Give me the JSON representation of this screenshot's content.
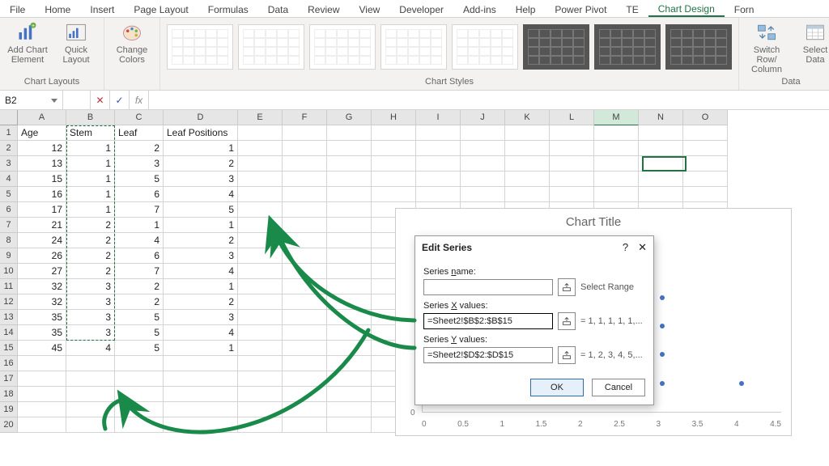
{
  "ribbon": {
    "tabs": [
      "File",
      "Home",
      "Insert",
      "Page Layout",
      "Formulas",
      "Data",
      "Review",
      "View",
      "Developer",
      "Add-ins",
      "Help",
      "Power Pivot",
      "TE",
      "Chart Design",
      "Forn"
    ],
    "active_tab": 13,
    "groups": {
      "layouts": {
        "label": "Chart Layouts",
        "add_element": "Add Chart Element",
        "quick_layout": "Quick Layout"
      },
      "styles": {
        "label": "Chart Styles",
        "change_colors": "Change Colors"
      },
      "data": {
        "label": "Data",
        "switch": "Switch Row/ Column",
        "select": "Select Data"
      }
    }
  },
  "namebox": "B2",
  "columns": [
    "A",
    "B",
    "C",
    "D",
    "E",
    "F",
    "G",
    "H",
    "I",
    "J",
    "K",
    "L",
    "M",
    "N",
    "O"
  ],
  "headers": {
    "A": "Age",
    "B": "Stem",
    "C": "Leaf",
    "D": "Leaf Positions"
  },
  "rows": [
    {
      "A": 12,
      "B": 1,
      "C": 2,
      "D": 1
    },
    {
      "A": 13,
      "B": 1,
      "C": 3,
      "D": 2
    },
    {
      "A": 15,
      "B": 1,
      "C": 5,
      "D": 3
    },
    {
      "A": 16,
      "B": 1,
      "C": 6,
      "D": 4
    },
    {
      "A": 17,
      "B": 1,
      "C": 7,
      "D": 5
    },
    {
      "A": 21,
      "B": 2,
      "C": 1,
      "D": 1
    },
    {
      "A": 24,
      "B": 2,
      "C": 4,
      "D": 2
    },
    {
      "A": 26,
      "B": 2,
      "C": 6,
      "D": 3
    },
    {
      "A": 27,
      "B": 2,
      "C": 7,
      "D": 4
    },
    {
      "A": 32,
      "B": 3,
      "C": 2,
      "D": 1
    },
    {
      "A": 32,
      "B": 3,
      "C": 2,
      "D": 2
    },
    {
      "A": 35,
      "B": 3,
      "C": 5,
      "D": 3
    },
    {
      "A": 35,
      "B": 3,
      "C": 5,
      "D": 4
    },
    {
      "A": 45,
      "B": 4,
      "C": 5,
      "D": 1
    }
  ],
  "chart": {
    "title": "Chart Title",
    "xticks": [
      "0",
      "0.5",
      "1",
      "1.5",
      "2",
      "2.5",
      "3",
      "3.5",
      "4",
      "4.5"
    ],
    "ytick0": "0"
  },
  "chart_data": {
    "type": "scatter",
    "title": "Chart Title",
    "xlabel": "",
    "ylabel": "",
    "xlim": [
      0,
      4.5
    ],
    "series": [
      {
        "name": "",
        "x": [
          1,
          1,
          1,
          1,
          1,
          2,
          2,
          2,
          2,
          3,
          3,
          3,
          3,
          4
        ],
        "y": [
          1,
          2,
          3,
          4,
          5,
          1,
          2,
          3,
          4,
          1,
          2,
          3,
          4,
          1
        ]
      }
    ]
  },
  "dialog": {
    "title": "Edit Series",
    "name_label": "Series name:",
    "name_value": "",
    "name_hint": "Select Range",
    "x_label": "Series X values:",
    "x_value": "=Sheet2!$B$2:$B$15",
    "x_hint": "= 1, 1, 1, 1, 1,...",
    "y_label": "Series Y values:",
    "y_value": "=Sheet2!$D$2:$D$15",
    "y_hint": "= 1, 2, 3, 4, 5,...",
    "ok": "OK",
    "cancel": "Cancel",
    "help": "?",
    "close": "✕"
  },
  "colors": {
    "excel_green": "#217346",
    "anno_green": "#1a8a4a"
  }
}
